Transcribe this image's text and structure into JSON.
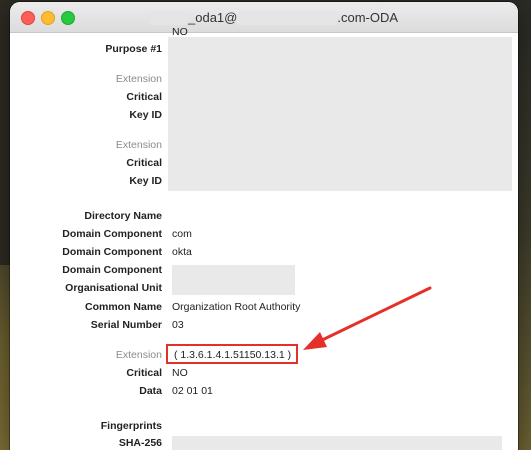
{
  "window": {
    "title_prefix": "_oda1@",
    "title_suffix": ".com-ODA"
  },
  "cut_off": {
    "critical_value": "NO",
    "sha256_label": "SHA-256"
  },
  "sections": {
    "purpose_label": "Purpose #1",
    "ext1": {
      "extension": "Extension",
      "critical": "Critical",
      "key_id": "Key ID"
    },
    "ext2": {
      "extension": "Extension",
      "critical": "Critical",
      "key_id": "Key ID"
    },
    "directory": {
      "title": "Directory Name",
      "rows": [
        {
          "label": "Domain Component",
          "value": "com"
        },
        {
          "label": "Domain Component",
          "value": "okta"
        },
        {
          "label": "Domain Component",
          "value": ""
        },
        {
          "label": "Organisational Unit",
          "value": ""
        },
        {
          "label": "Common Name",
          "value": "Organization Root Authority"
        },
        {
          "label": "Serial Number",
          "value": "03"
        }
      ]
    },
    "ext3": {
      "extension_label": "Extension",
      "extension_value": "( 1.3.6.1.4.1.51150.13.1 )",
      "critical_label": "Critical",
      "critical_value": "NO",
      "data_label": "Data",
      "data_value": "02 01 01"
    },
    "fingerprints_label": "Fingerprints"
  },
  "colors": {
    "annotation": "#e5302a"
  }
}
